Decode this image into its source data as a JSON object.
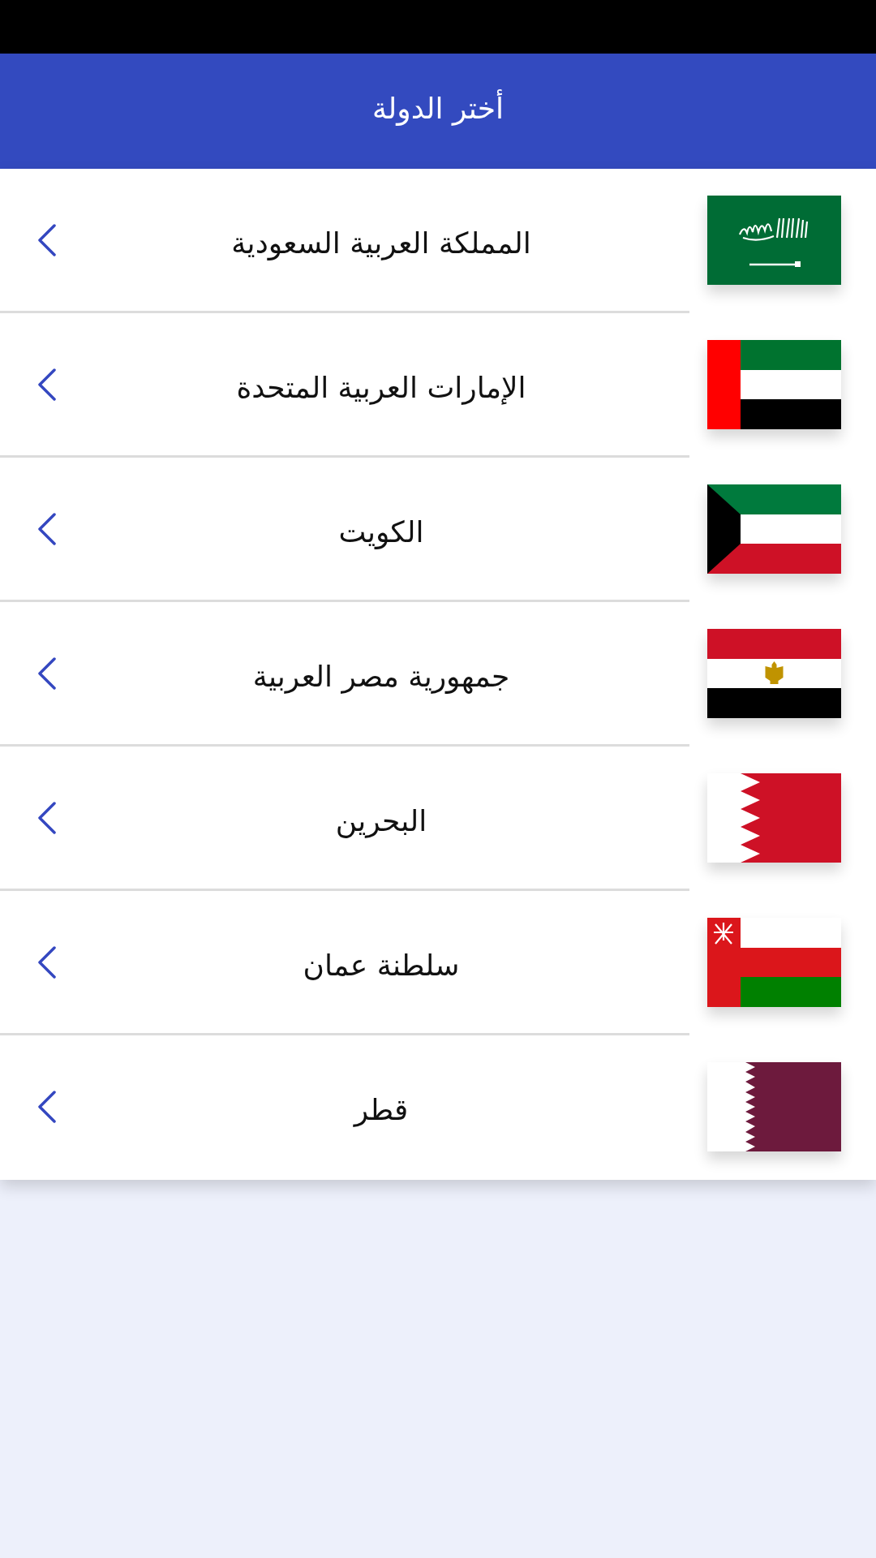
{
  "app_bar": {
    "title": "أختر الدولة"
  },
  "countries": [
    {
      "name": "المملكة العربية السعودية",
      "kind": "sa"
    },
    {
      "name": "الإمارات العربية المتحدة",
      "kind": "ae"
    },
    {
      "name": "الكويت",
      "kind": "kw"
    },
    {
      "name": "جمهورية مصر العربية",
      "kind": "eg"
    },
    {
      "name": "البحرين",
      "kind": "bh"
    },
    {
      "name": "سلطنة عمان",
      "kind": "om"
    },
    {
      "name": "قطر",
      "kind": "qa"
    }
  ]
}
